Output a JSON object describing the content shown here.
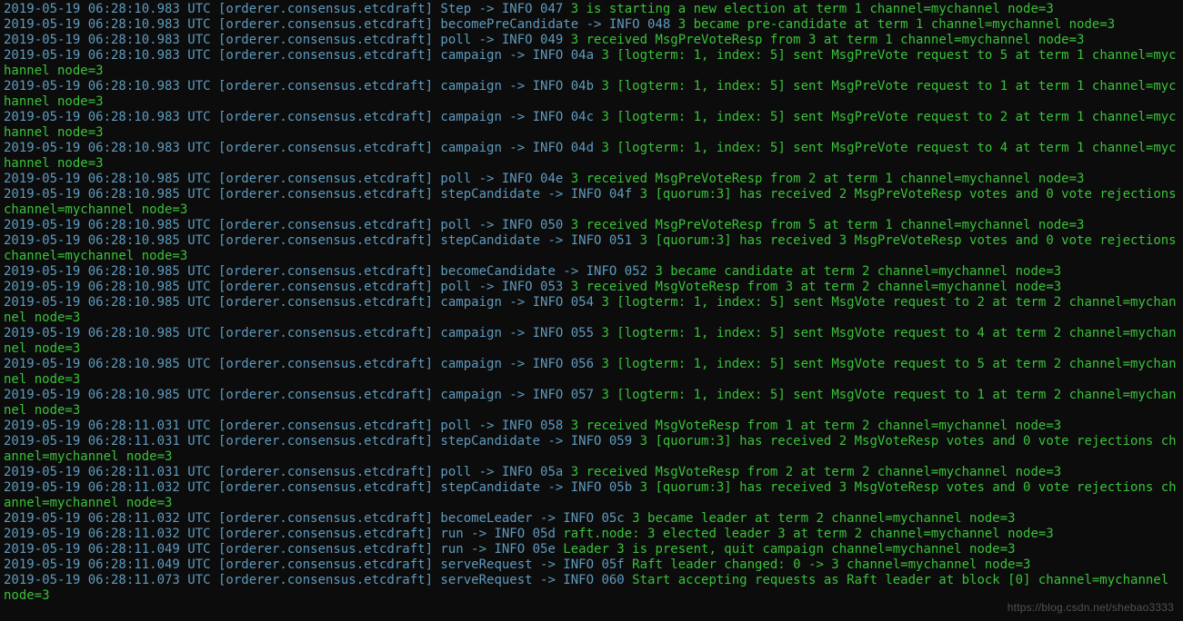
{
  "watermark": "https://blog.csdn.net/shebao3333",
  "log_lines": [
    {
      "prefix": "2019-05-19 06:28:10.983 UTC [orderer.consensus.etcdraft] Step -> INFO 047 ",
      "msg": "3 is starting a new election at term 1 channel=mychannel node=3"
    },
    {
      "prefix": "2019-05-19 06:28:10.983 UTC [orderer.consensus.etcdraft] becomePreCandidate -> INFO 048 ",
      "msg": "3 became pre-candidate at term 1 channel=mychannel node=3"
    },
    {
      "prefix": "2019-05-19 06:28:10.983 UTC [orderer.consensus.etcdraft] poll -> INFO 049 ",
      "msg": "3 received MsgPreVoteResp from 3 at term 1 channel=mychannel node=3"
    },
    {
      "prefix": "2019-05-19 06:28:10.983 UTC [orderer.consensus.etcdraft] campaign -> INFO 04a ",
      "msg": "3 [logterm: 1, index: 5] sent MsgPreVote request to 5 at term 1 channel=mychannel node=3"
    },
    {
      "prefix": "2019-05-19 06:28:10.983 UTC [orderer.consensus.etcdraft] campaign -> INFO 04b ",
      "msg": "3 [logterm: 1, index: 5] sent MsgPreVote request to 1 at term 1 channel=mychannel node=3"
    },
    {
      "prefix": "2019-05-19 06:28:10.983 UTC [orderer.consensus.etcdraft] campaign -> INFO 04c ",
      "msg": "3 [logterm: 1, index: 5] sent MsgPreVote request to 2 at term 1 channel=mychannel node=3"
    },
    {
      "prefix": "2019-05-19 06:28:10.983 UTC [orderer.consensus.etcdraft] campaign -> INFO 04d ",
      "msg": "3 [logterm: 1, index: 5] sent MsgPreVote request to 4 at term 1 channel=mychannel node=3"
    },
    {
      "prefix": "2019-05-19 06:28:10.985 UTC [orderer.consensus.etcdraft] poll -> INFO 04e ",
      "msg": "3 received MsgPreVoteResp from 2 at term 1 channel=mychannel node=3"
    },
    {
      "prefix": "2019-05-19 06:28:10.985 UTC [orderer.consensus.etcdraft] stepCandidate -> INFO 04f ",
      "msg": "3 [quorum:3] has received 2 MsgPreVoteResp votes and 0 vote rejections channel=mychannel node=3"
    },
    {
      "prefix": "2019-05-19 06:28:10.985 UTC [orderer.consensus.etcdraft] poll -> INFO 050 ",
      "msg": "3 received MsgPreVoteResp from 5 at term 1 channel=mychannel node=3"
    },
    {
      "prefix": "2019-05-19 06:28:10.985 UTC [orderer.consensus.etcdraft] stepCandidate -> INFO 051 ",
      "msg": "3 [quorum:3] has received 3 MsgPreVoteResp votes and 0 vote rejections channel=mychannel node=3"
    },
    {
      "prefix": "2019-05-19 06:28:10.985 UTC [orderer.consensus.etcdraft] becomeCandidate -> INFO 052 ",
      "msg": "3 became candidate at term 2 channel=mychannel node=3"
    },
    {
      "prefix": "2019-05-19 06:28:10.985 UTC [orderer.consensus.etcdraft] poll -> INFO 053 ",
      "msg": "3 received MsgVoteResp from 3 at term 2 channel=mychannel node=3"
    },
    {
      "prefix": "2019-05-19 06:28:10.985 UTC [orderer.consensus.etcdraft] campaign -> INFO 054 ",
      "msg": "3 [logterm: 1, index: 5] sent MsgVote request to 2 at term 2 channel=mychannel node=3"
    },
    {
      "prefix": "2019-05-19 06:28:10.985 UTC [orderer.consensus.etcdraft] campaign -> INFO 055 ",
      "msg": "3 [logterm: 1, index: 5] sent MsgVote request to 4 at term 2 channel=mychannel node=3"
    },
    {
      "prefix": "2019-05-19 06:28:10.985 UTC [orderer.consensus.etcdraft] campaign -> INFO 056 ",
      "msg": "3 [logterm: 1, index: 5] sent MsgVote request to 5 at term 2 channel=mychannel node=3"
    },
    {
      "prefix": "2019-05-19 06:28:10.985 UTC [orderer.consensus.etcdraft] campaign -> INFO 057 ",
      "msg": "3 [logterm: 1, index: 5] sent MsgVote request to 1 at term 2 channel=mychannel node=3"
    },
    {
      "prefix": "2019-05-19 06:28:11.031 UTC [orderer.consensus.etcdraft] poll -> INFO 058 ",
      "msg": "3 received MsgVoteResp from 1 at term 2 channel=mychannel node=3"
    },
    {
      "prefix": "2019-05-19 06:28:11.031 UTC [orderer.consensus.etcdraft] stepCandidate -> INFO 059 ",
      "msg": "3 [quorum:3] has received 2 MsgVoteResp votes and 0 vote rejections channel=mychannel node=3"
    },
    {
      "prefix": "2019-05-19 06:28:11.031 UTC [orderer.consensus.etcdraft] poll -> INFO 05a ",
      "msg": "3 received MsgVoteResp from 2 at term 2 channel=mychannel node=3"
    },
    {
      "prefix": "2019-05-19 06:28:11.032 UTC [orderer.consensus.etcdraft] stepCandidate -> INFO 05b ",
      "msg": "3 [quorum:3] has received 3 MsgVoteResp votes and 0 vote rejections channel=mychannel node=3"
    },
    {
      "prefix": "2019-05-19 06:28:11.032 UTC [orderer.consensus.etcdraft] becomeLeader -> INFO 05c ",
      "msg": "3 became leader at term 2 channel=mychannel node=3"
    },
    {
      "prefix": "2019-05-19 06:28:11.032 UTC [orderer.consensus.etcdraft] run -> INFO 05d ",
      "msg": "raft.node: 3 elected leader 3 at term 2 channel=mychannel node=3"
    },
    {
      "prefix": "2019-05-19 06:28:11.049 UTC [orderer.consensus.etcdraft] run -> INFO 05e ",
      "msg": "Leader 3 is present, quit campaign channel=mychannel node=3"
    },
    {
      "prefix": "2019-05-19 06:28:11.049 UTC [orderer.consensus.etcdraft] serveRequest -> INFO 05f ",
      "msg": "Raft leader changed: 0 -> 3 channel=mychannel node=3"
    },
    {
      "prefix": "2019-05-19 06:28:11.073 UTC [orderer.consensus.etcdraft] serveRequest -> INFO 060 ",
      "msg": "Start accepting requests as Raft leader at block [0] channel=mychannel node=3"
    }
  ]
}
